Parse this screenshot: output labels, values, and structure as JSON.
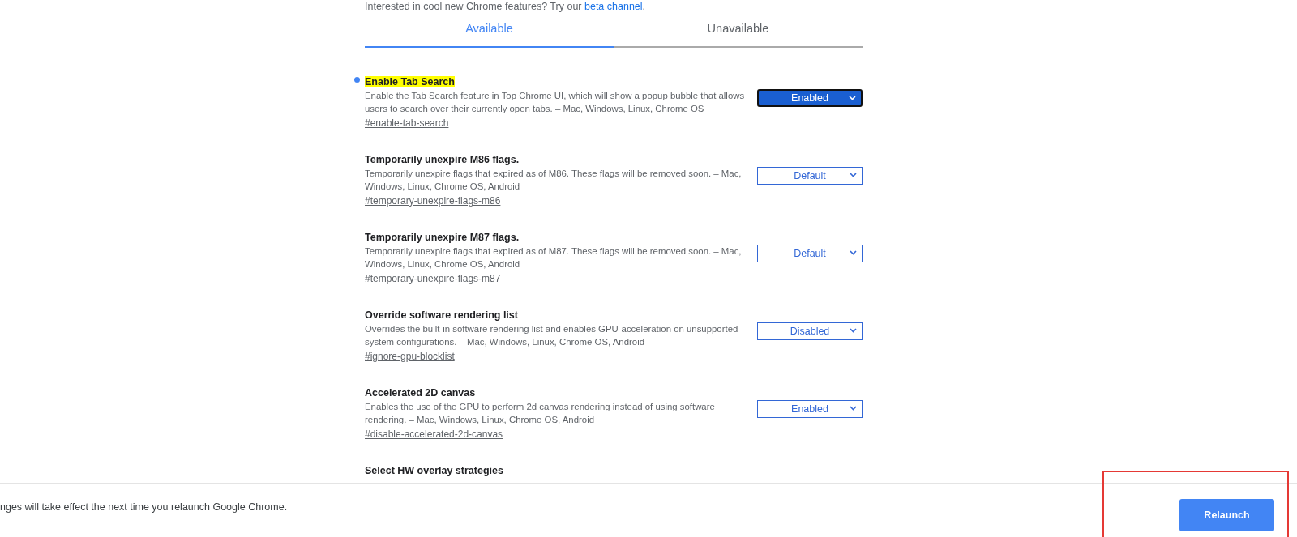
{
  "intro": {
    "text": "Interested in cool new Chrome features? Try our",
    "link": "beta channel",
    "end": "."
  },
  "tabs": [
    {
      "label": "Available",
      "selected": true
    },
    {
      "label": "Unavailable",
      "selected": false
    }
  ],
  "flags": [
    {
      "title": "Enable Tab Search",
      "modified": true,
      "highlighted": true,
      "description": "Enable the Tab Search feature in Top Chrome UI, which will show a popup bubble that allows users to search over their currently open tabs. – Mac, Windows, Linux, Chrome OS",
      "link": "#enable-tab-search",
      "value": "Enabled",
      "focused": true
    },
    {
      "title": "Temporarily unexpire M86 flags.",
      "modified": false,
      "highlighted": false,
      "description": "Temporarily unexpire flags that expired as of M86. These flags will be removed soon. – Mac, Windows, Linux, Chrome OS, Android",
      "link": "#temporary-unexpire-flags-m86",
      "value": "Default",
      "focused": false
    },
    {
      "title": "Temporarily unexpire M87 flags.",
      "modified": false,
      "highlighted": false,
      "description": "Temporarily unexpire flags that expired as of M87. These flags will be removed soon. – Mac, Windows, Linux, Chrome OS, Android",
      "link": "#temporary-unexpire-flags-m87",
      "value": "Default",
      "focused": false
    },
    {
      "title": "Override software rendering list",
      "modified": false,
      "highlighted": false,
      "description": "Overrides the built-in software rendering list and enables GPU-acceleration on unsupported system configurations. – Mac, Windows, Linux, Chrome OS, Android",
      "link": "#ignore-gpu-blocklist",
      "value": "Disabled",
      "focused": false
    },
    {
      "title": "Accelerated 2D canvas",
      "modified": false,
      "highlighted": false,
      "description": "Enables the use of the GPU to perform 2d canvas rendering instead of using software rendering. – Mac, Windows, Linux, Chrome OS, Android",
      "link": "#disable-accelerated-2d-canvas",
      "value": "Enabled",
      "focused": false
    },
    {
      "title": "Select HW overlay strategies"
    }
  ],
  "footer": {
    "message": "nges will take effect the next time you relaunch Google Chrome.",
    "button": "Relaunch",
    "annotation": {
      "kind": "frame"
    }
  }
}
